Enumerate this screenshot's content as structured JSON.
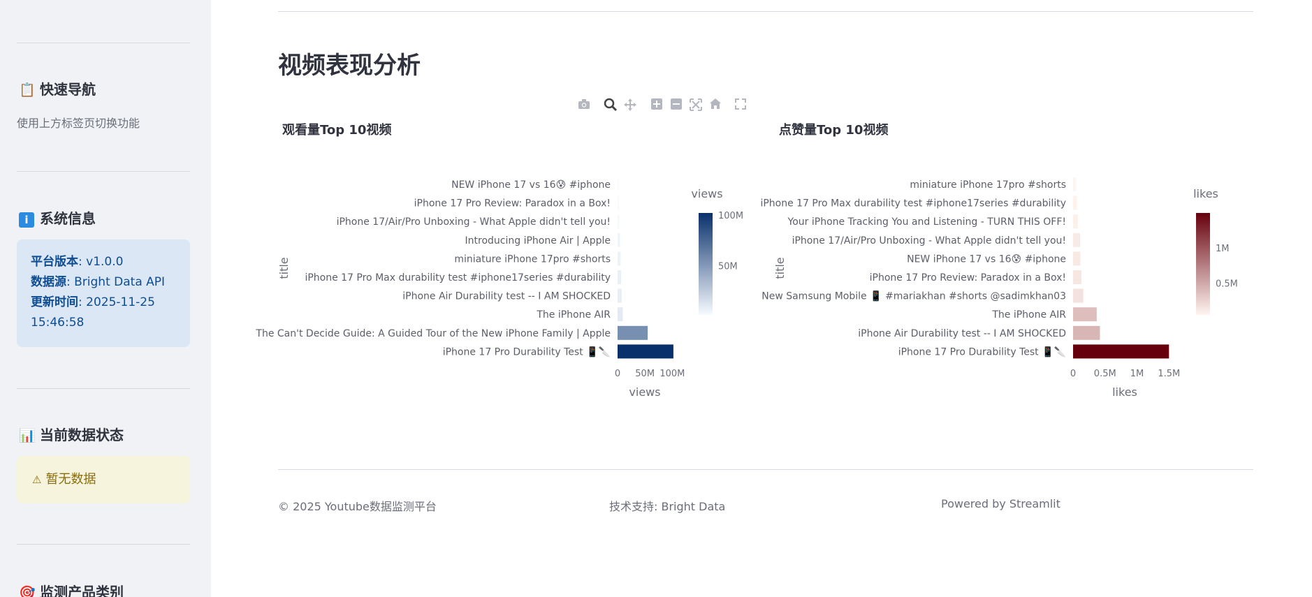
{
  "sidebar": {
    "nav_title": "快速导航",
    "nav_icon": "clipboard-icon",
    "nav_text": "使用上方标签页切换功能",
    "sys_title": "系统信息",
    "sys_icon": "info-icon",
    "sys": {
      "version_label": "平台版本",
      "version_value": ": v1.0.0",
      "source_label": "数据源",
      "source_value": ": Bright Data API",
      "updated_label": "更新时间",
      "updated_value": ": 2025-11-25",
      "updated_value2": "15:46:58"
    },
    "status_title": "当前数据状态",
    "status_icon": "bar-chart-icon",
    "status_warning": "暂无数据",
    "status_warning_icon": "warning-icon",
    "category_title": "监测产品类别",
    "category_icon": "target-icon"
  },
  "main": {
    "title": "视频表现分析",
    "footer": {
      "copyright": "© 2025 Youtube数据监测平台",
      "support": "技术支持: Bright Data",
      "powered": "Powered by Streamlit"
    }
  },
  "modebar": [
    "camera-icon",
    "zoom-icon",
    "pan-icon",
    "zoom-in-icon",
    "zoom-out-icon",
    "autoscale-icon",
    "reset-axes-icon",
    "fullscreen-icon"
  ],
  "colors": {
    "views_high": "#08306b",
    "views_low": "#f7fbff",
    "likes_high": "#67000d",
    "likes_low": "#fff5f0"
  },
  "chart_data": [
    {
      "type": "bar",
      "orientation": "horizontal",
      "title": "观看量Top 10视频",
      "xlabel": "views",
      "ylabel": "title",
      "colorbar_title": "views",
      "xlim": [
        0,
        120000000
      ],
      "xticks": [
        {
          "value": 0,
          "label": "0"
        },
        {
          "value": 50000000,
          "label": "50M"
        },
        {
          "value": 100000000,
          "label": "100M"
        }
      ],
      "colorbar_ticks": [
        {
          "value": 50000000,
          "label": "50M"
        },
        {
          "value": 100000000,
          "label": "100M"
        }
      ],
      "categories": [
        "NEW iPhone 17 vs 16😰 #iphone",
        "iPhone 17 Pro Review: Paradox in a Box!",
        "iPhone 17/Air/Pro Unboxing - What Apple didn't tell you!",
        "Introducing iPhone Air | Apple",
        "miniature iPhone 17pro #shorts",
        "iPhone 17 Pro Max durability test #iphone17series #durability",
        "iPhone Air Durability test -- I AM SHOCKED",
        "The iPhone AIR",
        "The Can't Decide Guide: A Guided Tour of the New iPhone Family | Apple",
        "iPhone 17 Pro Durability Test 📱🔪"
      ],
      "values": [
        1200000,
        2000000,
        2800000,
        4500000,
        5500000,
        6500000,
        7500000,
        9500000,
        55000000,
        102000000
      ]
    },
    {
      "type": "bar",
      "orientation": "horizontal",
      "title": "点赞量Top 10视频",
      "xlabel": "likes",
      "ylabel": "title",
      "colorbar_title": "likes",
      "xlim": [
        0,
        1650000
      ],
      "xticks": [
        {
          "value": 0,
          "label": "0"
        },
        {
          "value": 500000,
          "label": "0.5M"
        },
        {
          "value": 1000000,
          "label": "1M"
        },
        {
          "value": 1500000,
          "label": "1.5M"
        }
      ],
      "colorbar_ticks": [
        {
          "value": 500000,
          "label": "0.5M"
        },
        {
          "value": 1000000,
          "label": "1M"
        }
      ],
      "categories": [
        "miniature iPhone 17pro #shorts",
        "iPhone 17 Pro Max durability test #iphone17series #durability",
        "Your iPhone Tracking You and Listening - TURN THIS OFF!",
        "iPhone 17/Air/Pro Unboxing - What Apple didn't tell you!",
        "NEW iPhone 17 vs 16😰 #iphone",
        "iPhone 17 Pro Review: Paradox in a Box!",
        "New Samsung Mobile 📱 #mariakhan #shorts @sadimkhan03",
        "The iPhone AIR",
        "iPhone Air Durability test -- I AM SHOCKED",
        "iPhone 17 Pro Durability Test 📱🔪"
      ],
      "values": [
        45000,
        60000,
        75000,
        110000,
        115000,
        130000,
        160000,
        370000,
        420000,
        1500000
      ]
    }
  ]
}
